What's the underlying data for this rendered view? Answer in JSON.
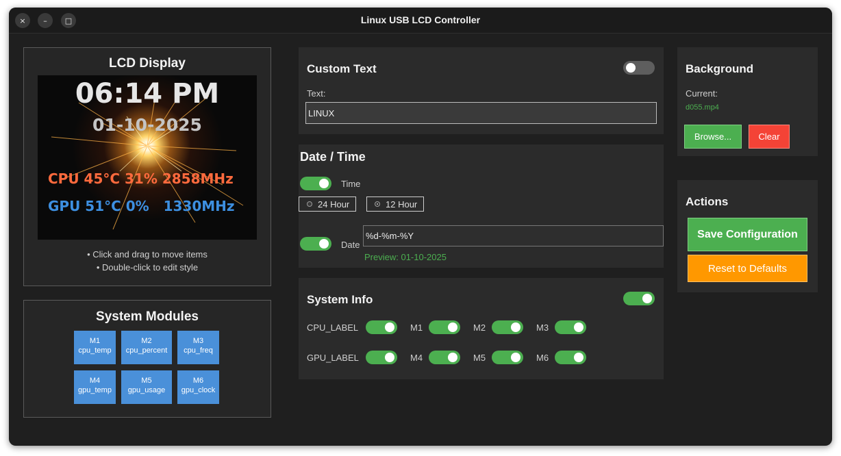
{
  "window": {
    "title": "Linux USB LCD Controller",
    "close_icon": "×",
    "minimize_icon": "–",
    "maximize_icon": "□"
  },
  "lcd_panel": {
    "title": "LCD Display",
    "time": "06:14 PM",
    "date": "01-10-2025",
    "cpu_line": "CPU 45°C 31% 2858MHz",
    "gpu_line": "GPU 51°C 0%   1330MHz",
    "hints": [
      "• Click and drag to move items",
      "• Double-click to edit style"
    ],
    "colors": {
      "cpu": "#ff6a3d",
      "gpu": "#3d8fe0",
      "date": "#c4c4c4",
      "time": "#ffffff"
    }
  },
  "modules_panel": {
    "title": "System Modules",
    "modules": [
      {
        "id": "M1",
        "name": "cpu_temp"
      },
      {
        "id": "M2",
        "name": "cpu_percent"
      },
      {
        "id": "M3",
        "name": "cpu_freq"
      },
      {
        "id": "M4",
        "name": "gpu_temp"
      },
      {
        "id": "M5",
        "name": "gpu_usage"
      },
      {
        "id": "M6",
        "name": "gpu_clock"
      }
    ]
  },
  "custom_text": {
    "title": "Custom Text",
    "enabled": false,
    "text_label": "Text:",
    "text_value": "LINUX"
  },
  "datetime": {
    "title": "Date / Time",
    "time_label": "Time",
    "time_enabled": true,
    "option_24": "24 Hour",
    "option_12": "12 Hour",
    "selected_format": "12 Hour",
    "date_label": "Date",
    "date_enabled": true,
    "date_format": "%d-%m-%Y",
    "preview": "Preview: 01-10-2025"
  },
  "system_info": {
    "title": "System Info",
    "enabled": true,
    "cpu_row": {
      "label": "CPU_LABEL",
      "items": [
        "M1",
        "M2",
        "M3"
      ]
    },
    "gpu_row": {
      "label": "GPU_LABEL",
      "items": [
        "M4",
        "M5",
        "M6"
      ]
    }
  },
  "background": {
    "title": "Background",
    "current_label": "Current:",
    "current_file": "d055.mp4",
    "browse_label": "Browse...",
    "clear_label": "Clear"
  },
  "actions": {
    "title": "Actions",
    "save_label": "Save Configuration",
    "reset_label": "Reset to Defaults"
  },
  "accent_colors": {
    "green": "#4caf50",
    "red": "#f44336",
    "orange": "#ff9800",
    "blue": "#4a90d9"
  }
}
